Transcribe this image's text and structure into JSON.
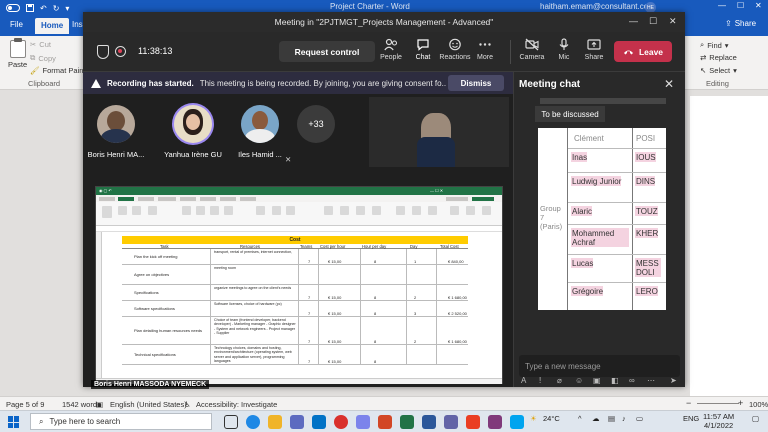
{
  "word": {
    "doc_title": "Project Charter - Word",
    "user": "haitham.emam@consultant.com",
    "avatar_initials": "HE",
    "tabs": [
      "File",
      "Home",
      "Ins"
    ],
    "share_label": "Share",
    "ribbon": {
      "paste": "Paste",
      "cut": "Cut",
      "copy": "Copy",
      "format_painter": "Format Painter",
      "clipboard": "Clipboard",
      "find": "Find",
      "replace": "Replace",
      "select": "Select",
      "editing": "Editing"
    },
    "status": {
      "page": "Page 5 of 9",
      "words": "1542 words",
      "language": "English (United States)",
      "accessibility": "Accessibility: Investigate",
      "zoom": "100%"
    }
  },
  "taskbar": {
    "search_placeholder": "Type here to search",
    "weather": "24°C",
    "lang": "ENG",
    "time": "11:57 AM",
    "date": "4/1/2022"
  },
  "teams": {
    "window_title": "Meeting in \"2PJTMGT_Projects Management - Advanced\"",
    "timer": "11:38:13",
    "request_control": "Request control",
    "controls": [
      {
        "label": "People"
      },
      {
        "label": "Chat"
      },
      {
        "label": "Reactions"
      },
      {
        "label": "More"
      },
      {
        "label": "Camera"
      },
      {
        "label": "Mic"
      },
      {
        "label": "Share"
      }
    ],
    "leave_label": "Leave",
    "banner": {
      "bold": "Recording has started.",
      "text": "This meeting is being recorded. By joining, you are giving consent fo...",
      "dismiss": "Dismiss"
    },
    "participants": [
      {
        "name": "Boris Henri MA..."
      },
      {
        "name": "Yanhua Irène GU"
      },
      {
        "name": "Iles Hamid ..."
      }
    ],
    "more_count": "+33",
    "presenter_tag": "Boris Henri MASSODA NYEMECK",
    "shared_sheet": {
      "header": "Cost",
      "columns": [
        "Task",
        "Resources",
        "Teams",
        "Cost per hour",
        "Hour per day",
        "Day",
        "Total Cost"
      ],
      "rows": [
        {
          "task": "Plan the kick off meeting",
          "res": "transport, rental of premises, internet connection,",
          "team": "7",
          "cph": "€ 15,00",
          "hpd": "8",
          "day": "1",
          "total": "€ 840,00"
        },
        {
          "task": "Agree on objectives",
          "res": "meeting room",
          "team": "",
          "cph": "",
          "hpd": "",
          "day": "",
          "total": ""
        },
        {
          "task": "Specifications",
          "res": "organize meetings to agree on the client's needs",
          "team": "7",
          "cph": "€ 15,00",
          "hpd": "8",
          "day": "2",
          "total": "€ 1 680,00"
        },
        {
          "task": "Software specifications",
          "res": "Software licenses, choice of hardware (pc)",
          "team": "7",
          "cph": "€ 15,00",
          "hpd": "8",
          "day": "3",
          "total": "€ 2 520,00"
        },
        {
          "task": "Plan detailing human resources needs",
          "res": "Choice of team (frontend developer, backend developer) - Marketing manager - Graphic designer - System and network engineers - Project manager - Supplier",
          "team": "7",
          "cph": "€ 15,00",
          "hpd": "8",
          "day": "2",
          "total": "€ 1 680,00"
        },
        {
          "task": "Technical specifications",
          "res": "Technology choices, domains and hosting, environment/architecture (operating system, web server and application server), programming languages",
          "team": "7",
          "cph": "€ 15,00",
          "hpd": "8",
          "day": "",
          "total": ""
        }
      ]
    }
  },
  "chat": {
    "title": "Meeting chat",
    "to_be_discussed": "To be discussed",
    "col_clement": "Clément",
    "col_pos": "POSI",
    "group_lines": [
      "Group",
      "7",
      "(Paris)"
    ],
    "names": [
      {
        "first": "Inas",
        "last": "IOUS"
      },
      {
        "first": "Ludwig Junior",
        "last": "DINS"
      },
      {
        "first": "Alaric",
        "last": "TOUZ"
      },
      {
        "first": "Mohammed Achraf",
        "last": "KHER"
      },
      {
        "first": "Lucas",
        "last": "MESS DOLI"
      },
      {
        "first": "Grégoire",
        "last": "LERO"
      }
    ],
    "input_placeholder": "Type a new message"
  },
  "colors": {
    "word_blue": "#185abd",
    "teams_leave": "#c4314b",
    "excel_yellow": "#ffcc00",
    "chat_highlight": "#f4d3e0"
  }
}
